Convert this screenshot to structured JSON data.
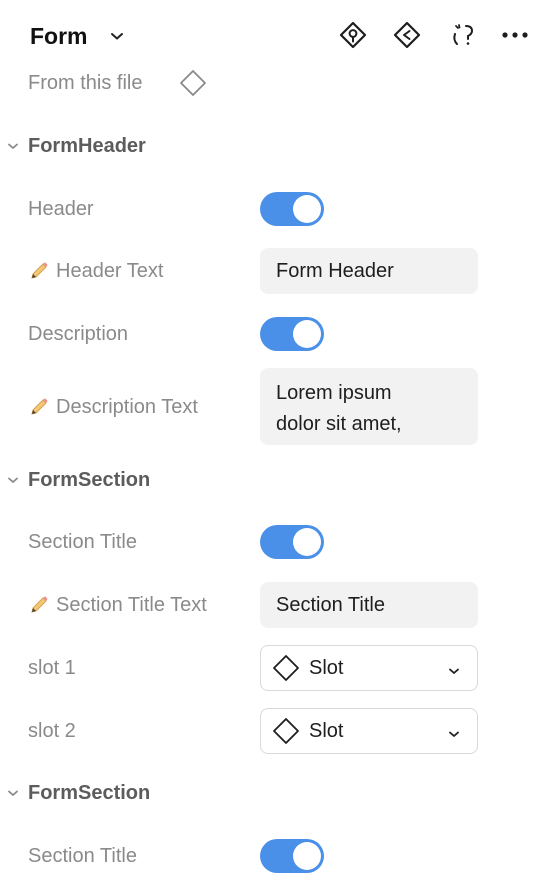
{
  "header": {
    "title": "Form",
    "from_this_file": "From this file",
    "actions": [
      {
        "name": "go-to-main-component-icon"
      },
      {
        "name": "reset-instance-icon"
      },
      {
        "name": "detach-instance-icon"
      },
      {
        "name": "more-options-icon"
      }
    ]
  },
  "sections": [
    {
      "label": "FormHeader",
      "props": [
        {
          "label": "Header",
          "type": "toggle",
          "value": true
        },
        {
          "label": "Header Text",
          "type": "text",
          "value": "Form Header"
        },
        {
          "label": "Description",
          "type": "toggle",
          "value": true
        },
        {
          "label": "Description Text",
          "type": "text",
          "value": "Lorem ipsum\ndolor sit amet,"
        }
      ]
    },
    {
      "label": "FormSection",
      "props": [
        {
          "label": "Section Title",
          "type": "toggle",
          "value": true
        },
        {
          "label": "Section Title Text",
          "type": "text",
          "value": "Section Title"
        },
        {
          "label": "slot 1",
          "type": "select",
          "value": "Slot"
        },
        {
          "label": "slot 2",
          "type": "select",
          "value": "Slot"
        }
      ]
    },
    {
      "label": "FormSection",
      "props": [
        {
          "label": "Section Title",
          "type": "toggle",
          "value": true
        }
      ]
    }
  ],
  "colors": {
    "toggle_on": "#4a90e8",
    "field_bg": "#f2f2f2",
    "muted_text": "#8a8a8a"
  }
}
